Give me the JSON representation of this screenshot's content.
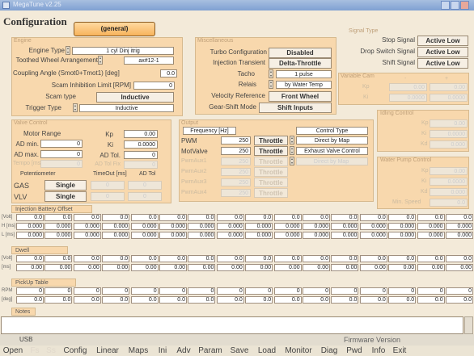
{
  "window": {
    "title": "MegaTune v2.25"
  },
  "page": {
    "title": "Configuration",
    "general_button": "(general)"
  },
  "engine": {
    "group": "Engine",
    "type_label": "Engine Type",
    "type_value": "1 cyl  Dinj  itrig",
    "wheel_label": "Toothed Wheel Arrangement",
    "wheel_value": "ax#12-1",
    "coupling_label": "Coupling Angle (Smot0+Tmot1) [deg]",
    "coupling_value": "0.0",
    "scam_inhibit_label": "Scam Inhibition Limit [RPM]",
    "scam_inhibit_value": "0",
    "scam_type_label": "Scam type",
    "scam_type_value": "Inductive",
    "trigger_label": "Trigger Type",
    "trigger_value": "Inductive"
  },
  "misc": {
    "group": "Miscellaneous",
    "turbo_label": "Turbo Configuration",
    "turbo_value": "Disabled",
    "injection_label": "Injection Transient",
    "injection_value": "Delta-Throttle",
    "tacho_label": "Tacho",
    "tacho_value": "1 pulse",
    "relais_label": "Relais",
    "relais_value": "by Water Temp",
    "velocity_label": "Velocity Reference",
    "velocity_value": "Front Wheel",
    "gearshift_label": "Gear-Shift Mode",
    "gearshift_value": "Shift Inputs"
  },
  "signal": {
    "group": "Signal Type",
    "stop_label": "Stop Signal",
    "stop_value": "Active Low",
    "drop_label": "Drop Switch Signal",
    "drop_value": "Active Low",
    "shift_label": "Shift Signal",
    "shift_value": "Active Low"
  },
  "variable_cam": {
    "group": "Variable Cam",
    "col_minus": "-",
    "col_plus": "+",
    "kp_label": "Kp",
    "ki_label": "Ki",
    "kp_minus": "0.00",
    "kp_plus": "0.00",
    "ki_minus": "0.0000",
    "ki_plus": "0.0000"
  },
  "idling": {
    "group": "Idling Control",
    "kp_label": "Kp",
    "ki_label": "Ki",
    "kd_label": "Kd",
    "kp": "0.00",
    "ki": "0.0000",
    "kd": "0.000"
  },
  "water_pump": {
    "group": "Water Pump Control",
    "kp_label": "Kp",
    "ki_label": "Ki",
    "kd_label": "Kd",
    "min_speed_label": "Min. Speed",
    "kp": "0.00",
    "ki": "0.0000",
    "kd": "0.000",
    "min_speed": "0.0"
  },
  "valve": {
    "group": "Valve Control",
    "motor_range": "Motor Range",
    "ad_min_label": "AD min.",
    "ad_min": "0",
    "ad_max_label": "AD max.",
    "ad_max": "0",
    "tempo_label": "Tempo [ms]",
    "tempo": "0",
    "kp_label": "Kp",
    "kp": "0.00",
    "ki_label": "Ki",
    "ki": "0.0000",
    "adtol_label": "AD Tol.",
    "adtol": "0",
    "adtolfix_label": "AD Tol Fix",
    "adtolfix": "0",
    "pot_label": "Potentiometer",
    "timeout_label": "TimeOut [ms]",
    "adtol2_label": "AD Tol",
    "gas_label": "GAS",
    "gas_value": "Single",
    "vlv_label": "VLV",
    "vlv_value": "Single",
    "gas_timeout": "0",
    "gas_adtol": "0",
    "vlv_timeout": "0",
    "vlv_adtol": "0"
  },
  "output": {
    "group": "Output",
    "freq_label": "Frequency [Hz]",
    "control_label": "Control Type",
    "rows": [
      {
        "label": "PWM",
        "freq": "250",
        "btn": "Throttle",
        "ctrl": "Direct by Map",
        "dis": false
      },
      {
        "label": "MotValve",
        "freq": "250",
        "btn": "Throttle",
        "ctrl": "Exhaust Valve Control",
        "dis": false
      },
      {
        "label": "PwmAux1",
        "freq": "250",
        "btn": "Throttle",
        "ctrl": "Direct by Map",
        "dis": true
      },
      {
        "label": "PwmAux2",
        "freq": "250",
        "btn": "Throttle",
        "ctrl": "",
        "dis": true
      },
      {
        "label": "PwmAux3",
        "freq": "250",
        "btn": "Throttle",
        "ctrl": "",
        "dis": true
      },
      {
        "label": "PwmAux4",
        "freq": "250",
        "btn": "Throttle",
        "ctrl": "",
        "dis": true
      }
    ]
  },
  "tables": {
    "injection_label": "Injection Battery Offset",
    "inj_rows": [
      {
        "label": "[Volt]",
        "values": [
          "0.0",
          "0.0",
          "0.0",
          "0.0",
          "0.0",
          "0.0",
          "0.0",
          "0.0",
          "0.0",
          "0.0",
          "0.0",
          "0.0",
          "0.0",
          "0.0",
          "0.0",
          "0.0"
        ]
      },
      {
        "label": "H [ms]",
        "values": [
          "0.000",
          "0.000",
          "0.000",
          "0.000",
          "0.000",
          "0.000",
          "0.000",
          "0.000",
          "0.000",
          "0.000",
          "0.000",
          "0.000",
          "0.000",
          "0.000",
          "0.000",
          "0.000"
        ]
      },
      {
        "label": "L [ms]",
        "values": [
          "0.000",
          "0.000",
          "0.000",
          "0.000",
          "0.000",
          "0.000",
          "0.000",
          "0.000",
          "0.000",
          "0.000",
          "0.000",
          "0.000",
          "0.000",
          "0.000",
          "0.000",
          "0.000"
        ]
      }
    ],
    "dwell_label": "Dwell",
    "dwell_rows": [
      {
        "label": "[Volt]",
        "values": [
          "0.0",
          "0.0",
          "0.0",
          "0.0",
          "0.0",
          "0.0",
          "0.0",
          "0.0",
          "0.0",
          "0.0",
          "0.0",
          "0.0",
          "0.0",
          "0.0",
          "0.0",
          "0.0"
        ]
      },
      {
        "label": "[ms]",
        "values": [
          "0.00",
          "0.00",
          "0.00",
          "0.00",
          "0.00",
          "0.00",
          "0.00",
          "0.00",
          "0.00",
          "0.00",
          "0.00",
          "0.00",
          "0.00",
          "0.00",
          "0.00",
          "0.00"
        ]
      }
    ],
    "pickup_label": "PickUp Table",
    "pickup_rows": [
      {
        "label": "RPM",
        "values": [
          "0",
          "0",
          "0",
          "0",
          "0",
          "0",
          "0",
          "0",
          "0",
          "0",
          "0",
          "0",
          "0",
          "0",
          "0",
          "0"
        ]
      },
      {
        "label": "[deg]",
        "values": [
          "0.0",
          "0.0",
          "0.0",
          "0.0",
          "0.0",
          "0.0",
          "0.0",
          "0.0",
          "0.0",
          "0.0",
          "0.0",
          "0.0",
          "0.0",
          "0.0",
          "0.0",
          "0.0"
        ]
      }
    ]
  },
  "notes_label": "Notes",
  "status": {
    "port": "USB",
    "firmware_label": "Firmware Version"
  },
  "tabs": [
    {
      "label": "Open",
      "w": 32,
      "dim": false
    },
    {
      "label": "Fs",
      "w": 18,
      "dim": true
    },
    {
      "label": "Ss",
      "w": 18,
      "dim": true
    },
    {
      "label": "Config",
      "w": 38,
      "dim": false
    },
    {
      "label": "Linear",
      "w": 38,
      "dim": false
    },
    {
      "label": "Maps",
      "w": 34,
      "dim": false
    },
    {
      "label": "Ini",
      "w": 22,
      "dim": false
    },
    {
      "label": "Adv",
      "w": 26,
      "dim": false
    },
    {
      "label": "Param",
      "w": 36,
      "dim": false
    },
    {
      "label": "Save",
      "w": 32,
      "dim": false
    },
    {
      "label": "Load",
      "w": 32,
      "dim": false
    },
    {
      "label": "Monitor",
      "w": 42,
      "dim": false
    },
    {
      "label": "Diag",
      "w": 30,
      "dim": false
    },
    {
      "label": "Pwd",
      "w": 28,
      "dim": false
    },
    {
      "label": "Info",
      "w": 28,
      "dim": false
    },
    {
      "label": "Exit",
      "w": 20,
      "dim": false
    }
  ],
  "colors": {
    "accent": "#f7b35c",
    "panel": "#f8d8ad",
    "arrow": "#0a6a1a"
  }
}
